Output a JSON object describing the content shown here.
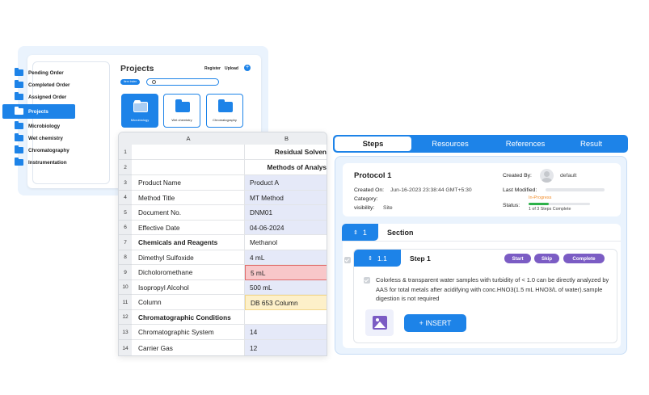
{
  "projects_panel": {
    "sidebar": {
      "items": [
        {
          "label": "Pending Order"
        },
        {
          "label": "Completed Order"
        },
        {
          "label": "Assigned Order"
        },
        {
          "label": "Projects"
        },
        {
          "label": "Microbiology"
        },
        {
          "label": "Wet chemistry"
        },
        {
          "label": "Chromatography"
        },
        {
          "label": "Instrumentation"
        }
      ],
      "active_item": "Projects"
    },
    "title": "Projects",
    "register_label": "Register",
    "upload_label": "Upload",
    "add_symbol": "+",
    "filter_label": "Item Index",
    "search": {
      "value": ""
    },
    "tiles": [
      {
        "label": "Microbiology",
        "active": true
      },
      {
        "label": "Wet chemistry",
        "active": false
      },
      {
        "label": "Chromatography",
        "active": false
      }
    ],
    "accent_color": "#1d83e8"
  },
  "spreadsheet": {
    "columns": [
      "A",
      "B"
    ],
    "rows": [
      {
        "num": "1",
        "a": "",
        "b": "Residual Solven"
      },
      {
        "num": "2",
        "a": "",
        "b": "Methods of Analys"
      },
      {
        "num": "3",
        "a": "Product Name",
        "b": "Product A"
      },
      {
        "num": "4",
        "a": "Method Title",
        "b": "MT Method"
      },
      {
        "num": "5",
        "a": "Document No.",
        "b": "DNM01"
      },
      {
        "num": "6",
        "a": "Effective Date",
        "b": "04-06-2024"
      },
      {
        "num": "7",
        "a": "Chemicals and Reagents",
        "b": "Methanol"
      },
      {
        "num": "8",
        "a": "Dimethyl Sulfoxide",
        "b": "4 mL"
      },
      {
        "num": "9",
        "a": "Dicholoromethane",
        "b": "5 mL"
      },
      {
        "num": "10",
        "a": "Isopropyl Alcohol",
        "b": "500 mL"
      },
      {
        "num": "11",
        "a": "Column",
        "b": "DB 653 Column"
      },
      {
        "num": "12",
        "a": "Chromatographic Conditions",
        "b": ""
      },
      {
        "num": "13",
        "a": "Chromatographic System",
        "b": "14"
      },
      {
        "num": "14",
        "a": "Carrier Gas",
        "b": "12"
      }
    ]
  },
  "protocol_panel": {
    "tabs": [
      {
        "label": "Steps",
        "active": true
      },
      {
        "label": "Resources",
        "active": false
      },
      {
        "label": "References",
        "active": false
      },
      {
        "label": "Result",
        "active": false
      }
    ],
    "title": "Protocol 1",
    "created_on_label": "Created On:",
    "created_on_value": "Jun-16-2023 23:38:44 GMT+5:30",
    "category_label": "Category:",
    "visibility_label": "visibility:",
    "visibility_value": "Site",
    "created_by_label": "Created By:",
    "created_by_value": "default",
    "last_modified_label": "Last Modified:",
    "status_label": "Status:",
    "status_tag": "In-Progress",
    "status_progress": 0.333,
    "status_steps": "1 of 3 Steps Complete",
    "section": {
      "number": "1",
      "label": "Section",
      "icon": "sort-icon"
    },
    "step": {
      "number": "1.1",
      "label": "Step 1",
      "buttons": [
        "Start",
        "Skip",
        "Complete"
      ],
      "description": "Colorless & transparent water samples with turbidity of < 1.0 can be directly analyzed by AAS for total metals after acidifying with conc.HNO3(1.5 mL HNO3/L of water).sample digestion is not  required",
      "insert_label": "+ INSERT"
    },
    "status_color": "#2db24a",
    "button_color": "#7b5cc4"
  }
}
